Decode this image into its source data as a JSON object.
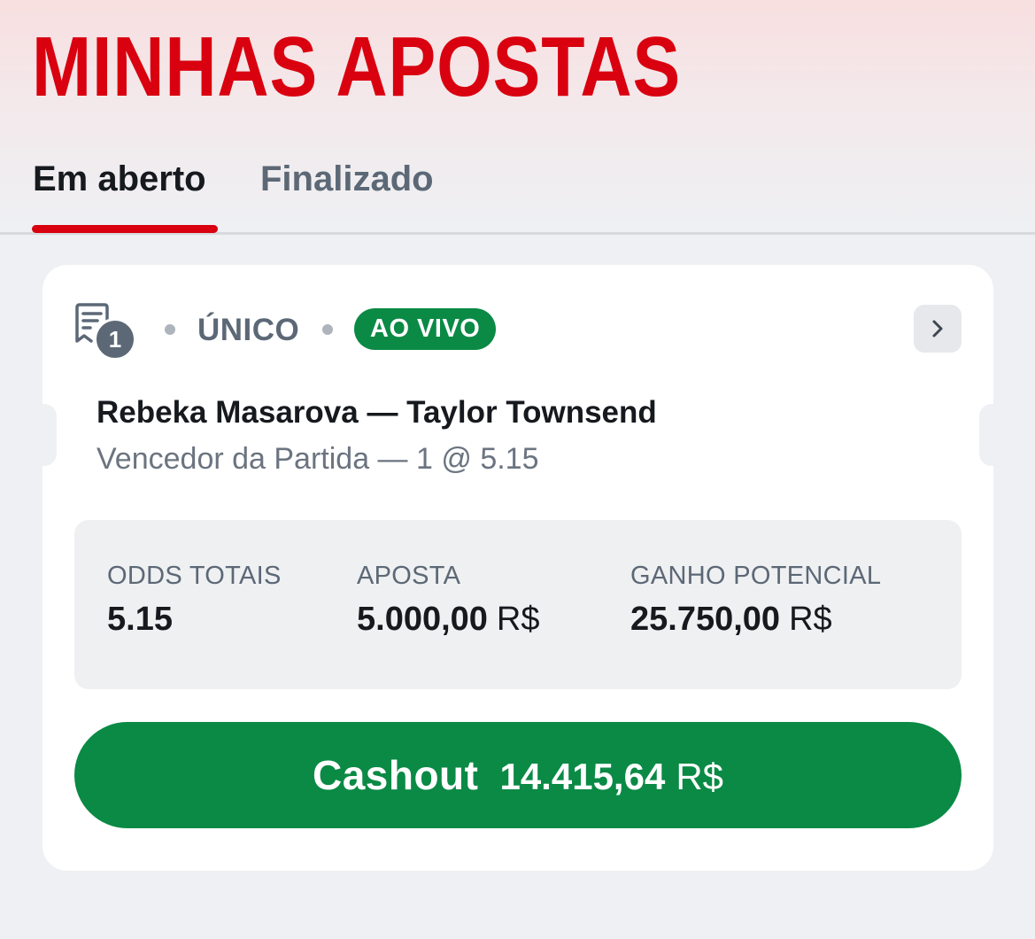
{
  "page": {
    "title": "MINHAS APOSTAS"
  },
  "tabs": [
    {
      "label": "Em aberto",
      "active": true
    },
    {
      "label": "Finalizado",
      "active": false
    }
  ],
  "bet": {
    "count": "1",
    "type": "ÚNICO",
    "status_badge": "AO VIVO",
    "match": "Rebeka Masarova — Taylor Townsend",
    "market": "Vencedor da Partida — 1 @ 5.15",
    "stats": {
      "total_odds_label": "ODDS TOTAIS",
      "total_odds_value": "5.15",
      "stake_label": "APOSTA",
      "stake_value": "5.000,00",
      "stake_currency": "R$",
      "potential_label": "GANHO POTENCIAL",
      "potential_value": "25.750,00",
      "potential_currency": "R$"
    },
    "cashout": {
      "label": "Cashout",
      "amount": "14.415,64",
      "currency": "R$"
    }
  },
  "colors": {
    "brand_red": "#d9000f",
    "live_green": "#0a8a45",
    "muted_text": "#5c6876"
  },
  "icons": {
    "bet_slip": "receipt-icon",
    "details": "chevron-right-icon"
  }
}
